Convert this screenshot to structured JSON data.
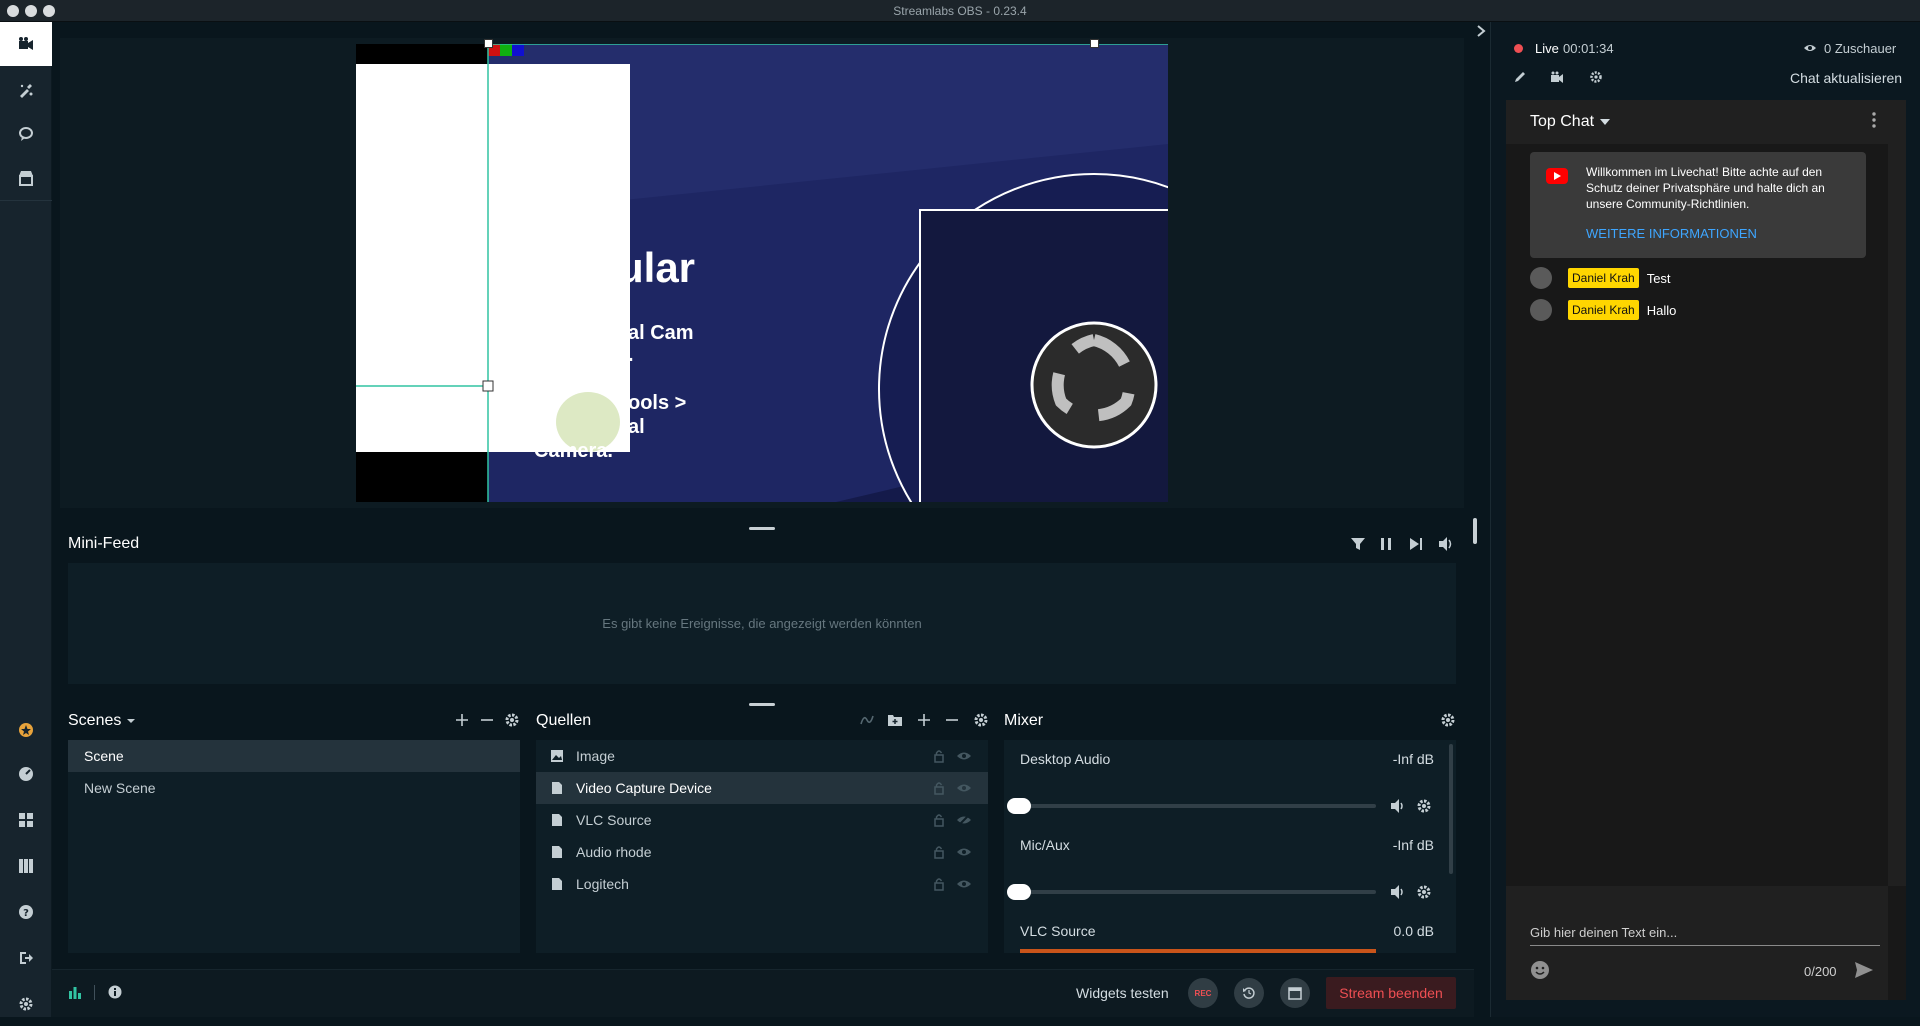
{
  "window": {
    "title": "Streamlabs OBS - 0.23.4"
  },
  "colors": {
    "accent": "#31c3a2",
    "live_red": "#ef4f53",
    "chat_badge": "#ffd600",
    "chat_link": "#3ea6ff",
    "youtube_red": "#ff0000"
  },
  "leftnav": {
    "top_items": [
      {
        "name": "studio-icon",
        "active": true
      },
      {
        "name": "themes-icon",
        "active": false
      },
      {
        "name": "chat-icon",
        "active": false
      },
      {
        "name": "store-icon",
        "active": false
      }
    ],
    "bottom_items": [
      "prime-icon",
      "dashboard-icon",
      "layout-icon",
      "library-icon",
      "help-icon",
      "logout-icon",
      "settings-icon"
    ]
  },
  "minifeed": {
    "title": "Mini-Feed",
    "empty_text": "Es gibt keine Ereignisse, die angezeigt werden könnten"
  },
  "preview": {
    "text_1": "ular",
    "text_2": "al Cam",
    "text_3": ".",
    "text_4": "ools >",
    "text_5": "al",
    "text_6": "Camera."
  },
  "scenes": {
    "title": "Scenes",
    "items": [
      {
        "label": "Scene",
        "selected": true
      },
      {
        "label": "New Scene",
        "selected": false
      }
    ]
  },
  "sources": {
    "title": "Quellen",
    "items": [
      {
        "label": "Image",
        "icon": "image-icon",
        "selected": false
      },
      {
        "label": "Video Capture Device",
        "icon": "file-icon",
        "selected": true
      },
      {
        "label": "VLC Source",
        "icon": "file-icon",
        "selected": false
      },
      {
        "label": "Audio rhode",
        "icon": "file-icon",
        "selected": false
      },
      {
        "label": "Logitech",
        "icon": "file-icon",
        "selected": false
      }
    ]
  },
  "mixer": {
    "title": "Mixer",
    "channels": [
      {
        "name": "Desktop Audio",
        "level": "-Inf dB"
      },
      {
        "name": "Mic/Aux",
        "level": "-Inf dB"
      },
      {
        "name": "VLC Source",
        "level": "0.0 dB"
      }
    ]
  },
  "footer": {
    "widgets_label": "Widgets testen",
    "rec_label": "REC",
    "stream_button": "Stream beenden"
  },
  "live": {
    "label": "Live",
    "time": "00:01:34",
    "viewers": "0 Zuschauer",
    "refresh_chat": "Chat aktualisieren"
  },
  "chat": {
    "mode": "Top Chat",
    "banner_text": "Willkommen im Livechat! Bitte achte auf den Schutz deiner Privatsphäre und halte dich an unsere Community-Richtlinien.",
    "banner_link": "WEITERE INFORMATIONEN",
    "messages": [
      {
        "author": "Daniel Krah",
        "text": "Test"
      },
      {
        "author": "Daniel Krah",
        "text": "Hallo"
      }
    ],
    "input_placeholder": "Gib hier deinen Text ein...",
    "char_count": "0/200"
  }
}
